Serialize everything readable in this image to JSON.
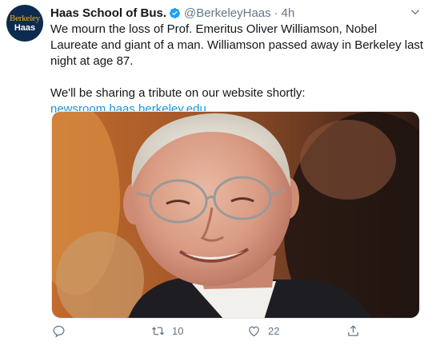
{
  "account": {
    "name": "Haas School of Bus.",
    "handle": "@BerkeleyHaas",
    "separator": "·",
    "time": "4h",
    "avatar_line1": "Berkeley",
    "avatar_line2": "Haas"
  },
  "tweet": {
    "text_paragraph1": "We mourn the loss of Prof. Emeritus Oliver Williamson, Nobel Laureate and giant of a man. Williamson passed away in Berkeley last night at age 87.",
    "text_paragraph2": "We'll be sharing a tribute on our website shortly:",
    "link": "newsroom.haas.berkeley.edu"
  },
  "actions": {
    "reply_count": "",
    "retweet_count": "10",
    "like_count": "22",
    "share_count": ""
  },
  "icons": {
    "verified": "verified-badge-icon",
    "more": "chevron-down-icon",
    "reply": "reply-icon",
    "retweet": "retweet-icon",
    "like": "heart-icon",
    "share": "share-icon"
  },
  "colors": {
    "link": "#1b95e0",
    "secondary_text": "#657786",
    "verified": "#1da1f2",
    "avatar_bg": "#0d2a4f",
    "avatar_gold": "#f5b21b"
  }
}
